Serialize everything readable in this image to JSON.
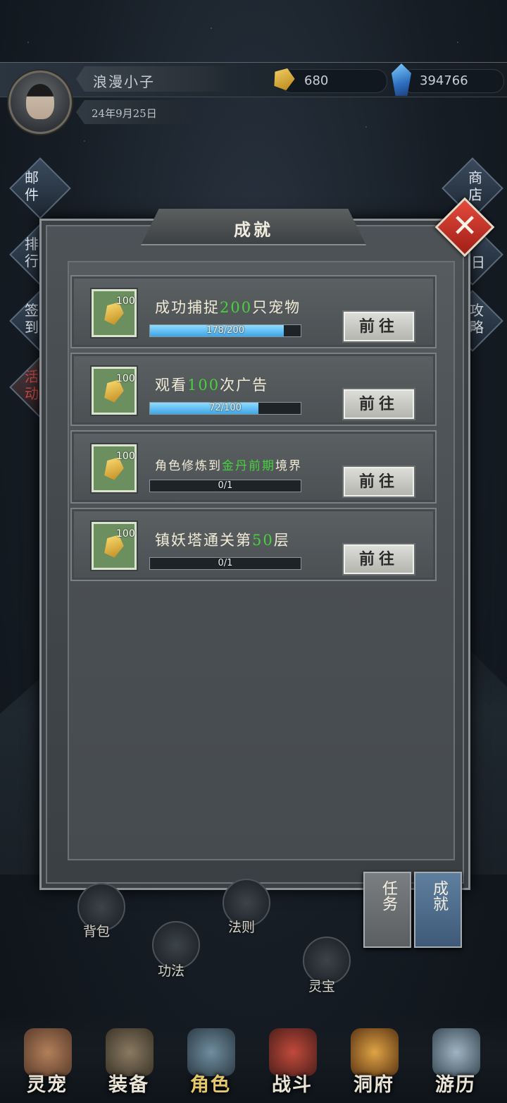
{
  "player": {
    "name": "浪漫小子",
    "date": "24年9月25日"
  },
  "currency": {
    "gold": "680",
    "crystal": "394766"
  },
  "side_left": [
    "邮件",
    "排行",
    "签到",
    "活动"
  ],
  "side_right": [
    "商店",
    "日",
    "攻略"
  ],
  "modal": {
    "title": "成就",
    "close": "✕"
  },
  "achievements": [
    {
      "reward": "100",
      "pre": "成功捕捉",
      "hl": "200",
      "post": "只宠物",
      "progress": "178/200",
      "progress_ratio": 0.89,
      "button": "前往"
    },
    {
      "reward": "100",
      "pre": "观看",
      "hl": "100",
      "post": "次广告",
      "progress": "72/100",
      "progress_ratio": 0.72,
      "button": "前往"
    },
    {
      "reward": "100",
      "pre": "角色修炼到",
      "hl": "金丹前期",
      "post": "境界",
      "progress": "0/1",
      "progress_ratio": 0,
      "button": "前往"
    },
    {
      "reward": "100",
      "pre": "镇妖塔通关第",
      "hl": "50",
      "post": "层",
      "progress": "0/1",
      "progress_ratio": 0,
      "button": "前往"
    }
  ],
  "tabs": {
    "task": "任务",
    "achievement": "成就"
  },
  "circle_menu": {
    "bag": "背包",
    "law": "法则",
    "skill": "功法",
    "treasure": "灵宝"
  },
  "nav": [
    "灵宠",
    "装备",
    "角色",
    "战斗",
    "洞府",
    "游历"
  ],
  "colors": {
    "highlight": "#45d23a",
    "progress": "#3ea5e6",
    "close": "#d23a2c",
    "active_nav": "#e6c86c"
  }
}
